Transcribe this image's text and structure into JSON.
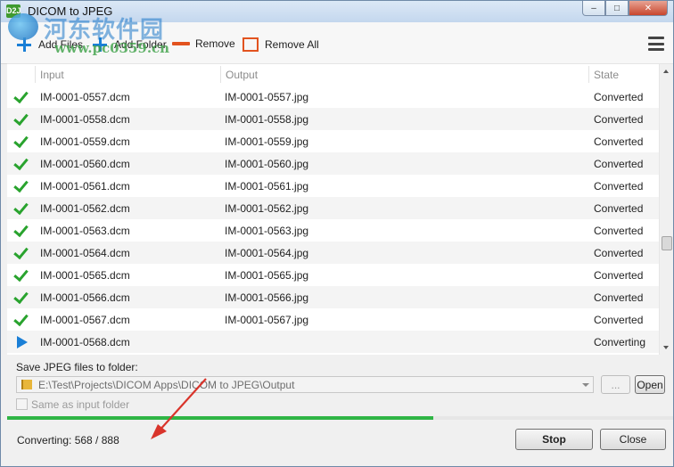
{
  "window": {
    "title": "DICOM to JPEG",
    "icon_text": "D2J",
    "controls": {
      "minimize": "–",
      "maximize": "□",
      "close": "✕"
    }
  },
  "watermark": {
    "line1": "河东软件园",
    "line2": "www.pc0359.cn"
  },
  "toolbar": {
    "add_files": "Add Files",
    "add_folder": "Add Folder",
    "remove": "Remove",
    "remove_all": "Remove All",
    "menu_icon": "hamburger-menu-icon"
  },
  "table": {
    "headers": {
      "input": "Input",
      "output": "Output",
      "state": "State"
    },
    "rows": [
      {
        "status_icon": "check-icon",
        "input": "IM-0001-0557.dcm",
        "output": "IM-0001-0557.jpg",
        "state": "Converted"
      },
      {
        "status_icon": "check-icon",
        "input": "IM-0001-0558.dcm",
        "output": "IM-0001-0558.jpg",
        "state": "Converted"
      },
      {
        "status_icon": "check-icon",
        "input": "IM-0001-0559.dcm",
        "output": "IM-0001-0559.jpg",
        "state": "Converted"
      },
      {
        "status_icon": "check-icon",
        "input": "IM-0001-0560.dcm",
        "output": "IM-0001-0560.jpg",
        "state": "Converted"
      },
      {
        "status_icon": "check-icon",
        "input": "IM-0001-0561.dcm",
        "output": "IM-0001-0561.jpg",
        "state": "Converted"
      },
      {
        "status_icon": "check-icon",
        "input": "IM-0001-0562.dcm",
        "output": "IM-0001-0562.jpg",
        "state": "Converted"
      },
      {
        "status_icon": "check-icon",
        "input": "IM-0001-0563.dcm",
        "output": "IM-0001-0563.jpg",
        "state": "Converted"
      },
      {
        "status_icon": "check-icon",
        "input": "IM-0001-0564.dcm",
        "output": "IM-0001-0564.jpg",
        "state": "Converted"
      },
      {
        "status_icon": "check-icon",
        "input": "IM-0001-0565.dcm",
        "output": "IM-0001-0565.jpg",
        "state": "Converted"
      },
      {
        "status_icon": "check-icon",
        "input": "IM-0001-0566.dcm",
        "output": "IM-0001-0566.jpg",
        "state": "Converted"
      },
      {
        "status_icon": "check-icon",
        "input": "IM-0001-0567.dcm",
        "output": "IM-0001-0567.jpg",
        "state": "Converted"
      },
      {
        "status_icon": "play-icon",
        "input": "IM-0001-0568.dcm",
        "output": "",
        "state": "Converting"
      }
    ]
  },
  "output": {
    "label": "Save JPEG files to folder:",
    "path": "E:\\Test\\Projects\\DICOM Apps\\DICOM to JPEG\\Output",
    "browse_label": "...",
    "open_label": "Open",
    "same_folder_label": "Same as input folder"
  },
  "progress": {
    "fraction": 0.64,
    "status": "Converting: 568 / 888"
  },
  "actions": {
    "stop": "Stop",
    "close": "Close"
  },
  "colors": {
    "success": "#29a32e",
    "accent": "#1a7fd6",
    "danger": "#e2531f",
    "progress": "#2fb545",
    "annotation_arrow": "#d9342b"
  }
}
